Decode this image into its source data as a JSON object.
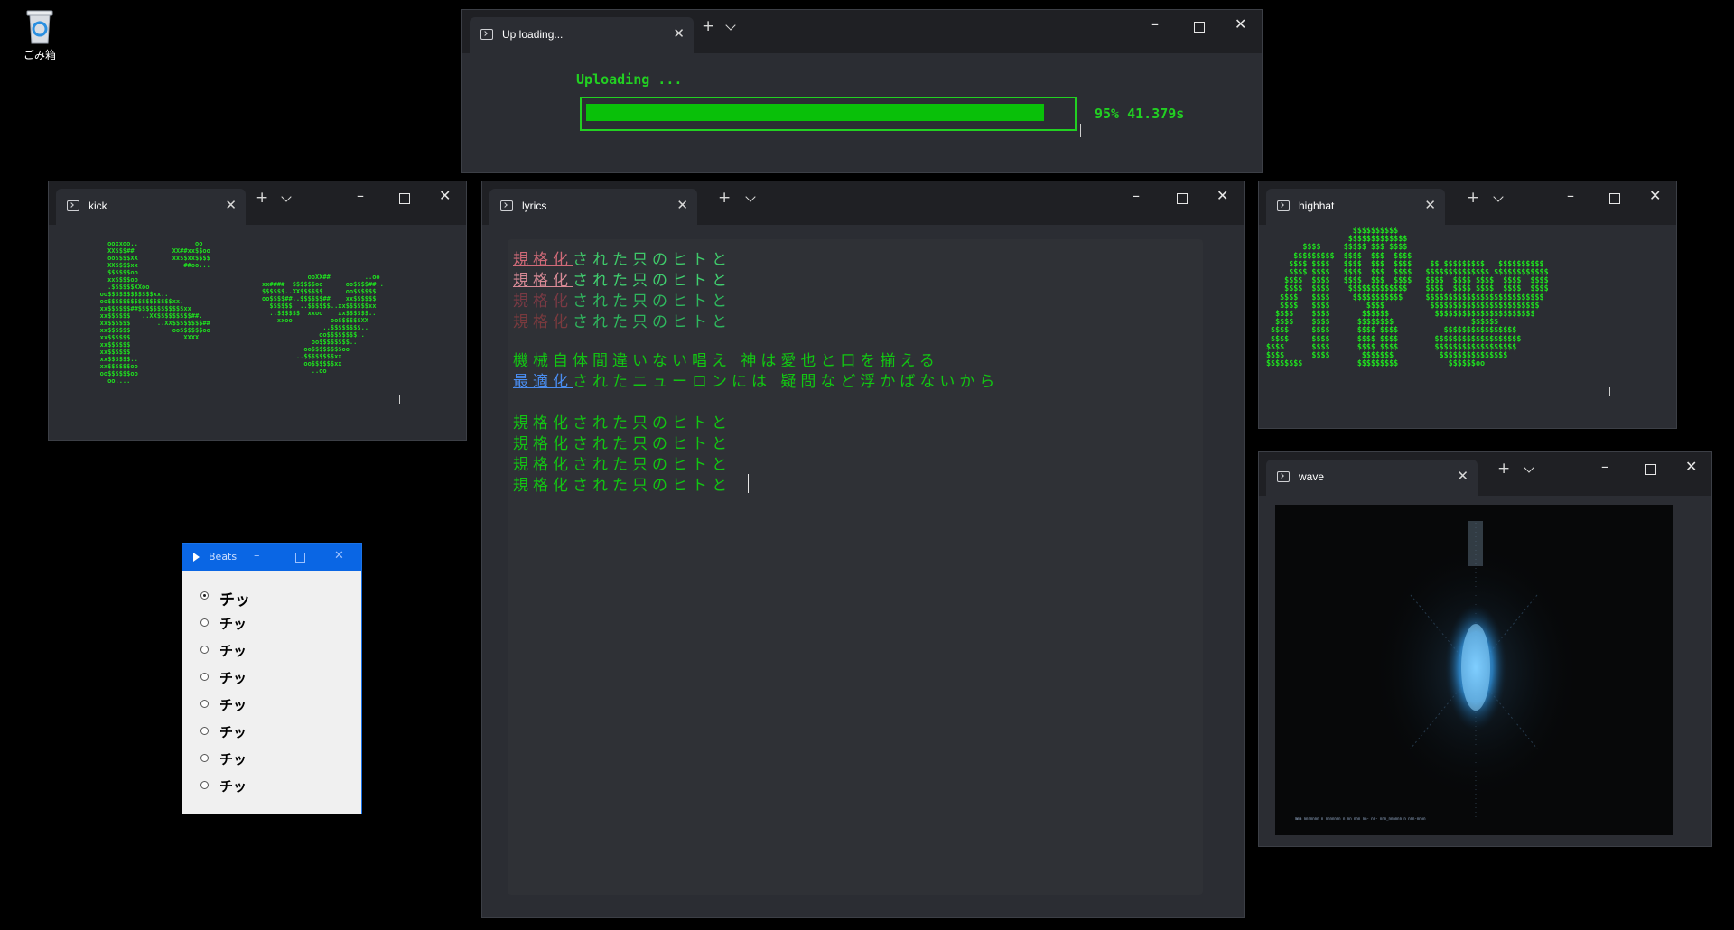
{
  "desktop": {
    "recycle_bin_label": "ごみ箱"
  },
  "upload_window": {
    "tab_title": "Up loading...",
    "status": "Uploading ...",
    "progress_fraction": 0.95,
    "progress_text": "95% 41.379s"
  },
  "kick_window": {
    "tab_title": "kick",
    "ascii": [
      "     ooxxoo..               oo",
      "     XX$$$##          XX##xx$$oo",
      "     oo$$$$XX         xx$$xx$$$$",
      "     XX$$$$xx            ##oo...",
      "     $$$$$$oo",
      "     xx$$$$oo",
      "     .$$$$$$XXoo",
      "   oo$$$$$$$$$$$$xx..",
      "   oo$$$$$$$$$$$$$$$$$xx.",
      "   xx$$$$$$##$$$$$$$$$$$$xx",
      "   xx$$$$$$   ..XX$$$$$$$$$##.",
      "   xx$$$$$$       ..XX$$$$$$$$##",
      "   xx$$$$$$           oo$$$$$$oo",
      "   xx$$$$$$              XXXX",
      "   xx$$$$$$",
      "   xx$$$$$$",
      "   xx$$$$$$..",
      "   xx$$$$$$oo",
      "   oo$$$$$$oo",
      "     oo...."
    ],
    "ascii2": [
      "            ooXX##         ..oo",
      "xx####  $$$$$$oo      oo$$$$##..",
      "$$$$$$..XX$$$$$$      oo$$$$$$",
      "oo$$$$##..$$$$$$##    xx$$$$$$",
      "  $$$$$$  ..$$$$$$..xx$$$$$$xx",
      "  ..$$$$$$  xxoo    xx$$$$$$..",
      "    xxoo          oo$$$$$$XX",
      "                ..$$$$$$$$..",
      "               oo$$$$$$$$..",
      "             oo$$$$$$$$..",
      "           oo$$$$$$$$oo",
      "         ..$$$$$$$$xx",
      "           oo$$$$$$xx",
      "             ..oo"
    ]
  },
  "lyrics_window": {
    "tab_title": "lyrics",
    "lines": [
      {
        "prefix": "規格化",
        "rest": "された只のヒトと"
      },
      {
        "prefix": "規格化",
        "rest": "された只のヒトと"
      },
      {
        "prefix": "規格化",
        "rest": "された只のヒトと"
      },
      {
        "prefix": "規格化",
        "rest": "された只のヒトと"
      },
      {
        "prefix": "",
        "rest": "機械自体間違いない唱え 神は愛也と口を揃える"
      },
      {
        "prefix": "最適化",
        "rest": "されたニューロンには 疑問など浮かばないから"
      },
      {
        "prefix": "",
        "rest": "規格化された只のヒトと"
      },
      {
        "prefix": "",
        "rest": "規格化された只のヒトと"
      },
      {
        "prefix": "",
        "rest": "規格化された只のヒトと"
      },
      {
        "prefix": "",
        "rest": "規格化された只のヒトと"
      }
    ]
  },
  "highhat_window": {
    "tab_title": "highhat",
    "ascii": [
      "                   $$$$$$$$$$",
      "                  $$$$$$$$$$$$$",
      "        $$$$     $$$$$ $$$ $$$$",
      "      $$$$$$$$$  $$$$  $$$  $$$$",
      "     $$$$ $$$$   $$$$  $$$  $$$$    $$ $$$$$$$$$   $$$$$$$$$$",
      "     $$$$ $$$$   $$$$  $$$  $$$$   $$$$$$$$$$$$$$ $$$$$$$$$$$$",
      "    $$$$  $$$$   $$$$  $$$  $$$$   $$$$  $$$$ $$$$  $$$$  $$$$",
      "    $$$$  $$$$    $$$$$$$$$$$$$    $$$$  $$$$ $$$$  $$$$  $$$$",
      "   $$$$   $$$$     $$$$$$$$$$$     $$$$$$$$$$$$$$$$$$$$$$$$$$",
      "   $$$$   $$$$        $$$$          $$$$$$$$$$$$$$$$$$$$$$$$",
      "  $$$$    $$$$       $$$$$$          $$$$$$$$$$$$$$$$$$$$$$",
      "  $$$$    $$$$      $$$$$$$$                 $$$$$$",
      " $$$$     $$$$      $$$$ $$$$          $$$$$$$$$$$$$$$$",
      " $$$$     $$$$      $$$$ $$$$        $$$$$$$$$$$$$$$$$$$",
      "$$$$      $$$$      $$$$ $$$$        $$$$$$$$$$$$$$$$$$",
      "$$$$      $$$$       $$$$$$$          $$$$$$$$$$$$$$$",
      "$$$$$$$$            $$$$$$$$$           $$$$$$oo"
    ]
  },
  "wave_window": {
    "tab_title": "wave",
    "status_line": "mmm nnnnnnn n nnnnnnn n nn nnn nn- nn-  nnn_nnnnnn n  nnn-nnnn"
  },
  "beats_window": {
    "title": "Beats",
    "options": [
      "チッ",
      "チッ",
      "チッ",
      "チッ",
      "チッ",
      "チッ",
      "チッ",
      "チッ"
    ],
    "selected_index": 0
  }
}
